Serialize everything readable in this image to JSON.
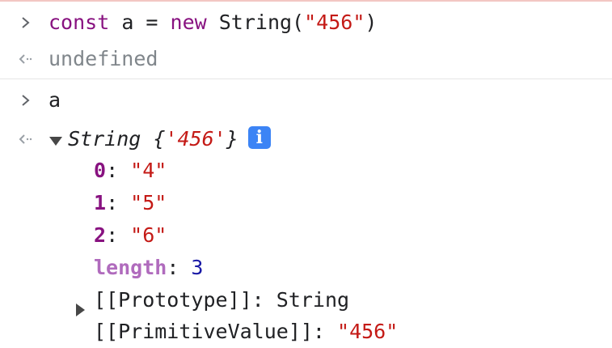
{
  "console": {
    "entry1": {
      "input": {
        "kw_const": "const",
        "var_name": " a = ",
        "kw_new": "new",
        "ctor": " String(",
        "arg": "\"456\"",
        "close": ")"
      },
      "result": "undefined"
    },
    "entry2": {
      "input": "a",
      "result": {
        "type_name": "String",
        "preview_open": " {",
        "preview_value": "'456'",
        "preview_close": "}",
        "info_icon": "i",
        "properties": [
          {
            "key": "0",
            "sep": ": ",
            "value": "\"4\""
          },
          {
            "key": "1",
            "sep": ": ",
            "value": "\"5\""
          },
          {
            "key": "2",
            "sep": ": ",
            "value": "\"6\""
          }
        ],
        "length": {
          "key": "length",
          "sep": ": ",
          "value": "3"
        },
        "prototype": {
          "key": "[[Prototype]]: ",
          "value": "String"
        },
        "primitive": {
          "key": "[[PrimitiveValue]]: ",
          "value": "\"456\""
        }
      }
    }
  },
  "icons": {
    "input_prompt": "chevron-right-icon",
    "output_return": "return-arrow-icon",
    "expanded": "triangle-down-icon",
    "collapsed": "triangle-right-icon",
    "info": "info-icon"
  },
  "colors": {
    "keyword": "#881280",
    "string": "#c41a16",
    "number": "#1a1aa6",
    "info_badge": "#3c84f5",
    "muted": "#80868b"
  }
}
